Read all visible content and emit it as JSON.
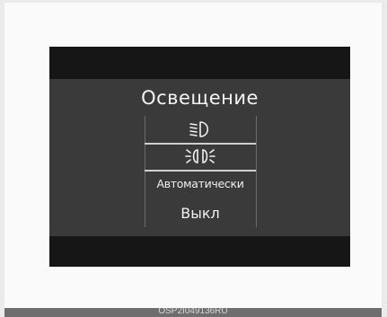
{
  "display": {
    "title": "Освещение",
    "options": [
      {
        "icon": "low-beam-headlight-icon",
        "label": ""
      },
      {
        "icon": "parking-lights-icon",
        "label": ""
      },
      {
        "label": "Автоматически"
      },
      {
        "label": "Выкл"
      }
    ],
    "selected_index": 1
  },
  "caption": "OSP2I049136RU",
  "colors": {
    "screen_bg": "#3a3a3a",
    "band": "#161616",
    "text": "#f0f0f0",
    "divider": "#cfcfcf"
  }
}
